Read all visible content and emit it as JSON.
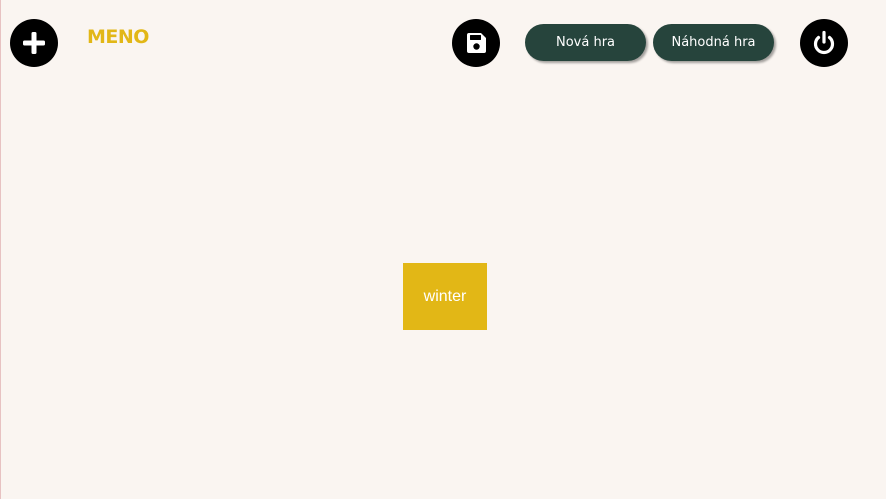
{
  "header": {
    "title": "MENO",
    "buttons": {
      "add_icon": "plus-icon",
      "save_icon": "floppy-disk-icon",
      "power_icon": "power-icon",
      "new_game_label": "Nová hra",
      "random_game_label": "Náhodná hra"
    }
  },
  "board": {
    "word_card": "winter"
  },
  "colors": {
    "accent": "#e2b716",
    "button_bg": "#26443c",
    "icon_button_bg": "#000000",
    "page_bg": "#faf5f1"
  }
}
